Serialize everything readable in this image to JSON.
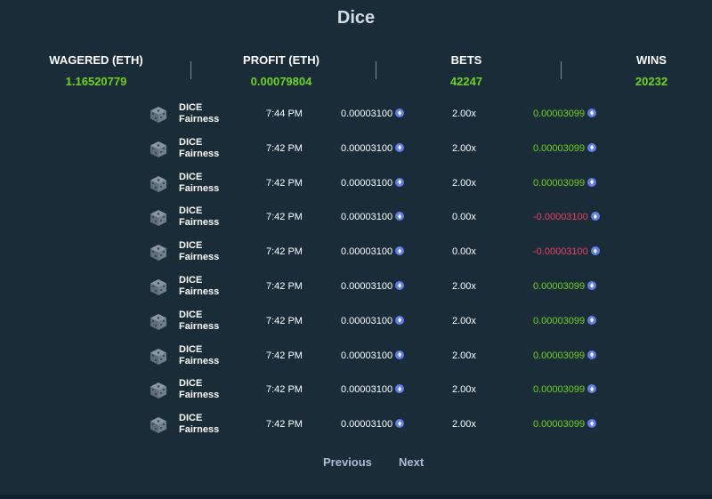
{
  "page": {
    "title": "Dice"
  },
  "stats": [
    {
      "label": "WAGERED (ETH)",
      "value": "1.16520779"
    },
    {
      "label": "PROFIT (ETH)",
      "value": "0.00079804"
    },
    {
      "label": "BETS",
      "value": "42247"
    },
    {
      "label": "WINS",
      "value": "20232"
    }
  ],
  "colors": {
    "positive": "#6fd322",
    "negative": "#ed4163",
    "eth_icon": "#627eea",
    "background": "#1a2c38"
  },
  "bet_rows": [
    {
      "game": "DICE",
      "link": "Fairness",
      "time": "7:44 PM",
      "amount": "0.00003100",
      "multiplier": "2.00x",
      "profit": "0.00003099",
      "outcome": "win"
    },
    {
      "game": "DICE",
      "link": "Fairness",
      "time": "7:42 PM",
      "amount": "0.00003100",
      "multiplier": "2.00x",
      "profit": "0.00003099",
      "outcome": "win"
    },
    {
      "game": "DICE",
      "link": "Fairness",
      "time": "7:42 PM",
      "amount": "0.00003100",
      "multiplier": "2.00x",
      "profit": "0.00003099",
      "outcome": "win"
    },
    {
      "game": "DICE",
      "link": "Fairness",
      "time": "7:42 PM",
      "amount": "0.00003100",
      "multiplier": "0.00x",
      "profit": "-0.00003100",
      "outcome": "loss"
    },
    {
      "game": "DICE",
      "link": "Fairness",
      "time": "7:42 PM",
      "amount": "0.00003100",
      "multiplier": "0.00x",
      "profit": "-0.00003100",
      "outcome": "loss"
    },
    {
      "game": "DICE",
      "link": "Fairness",
      "time": "7:42 PM",
      "amount": "0.00003100",
      "multiplier": "2.00x",
      "profit": "0.00003099",
      "outcome": "win"
    },
    {
      "game": "DICE",
      "link": "Fairness",
      "time": "7:42 PM",
      "amount": "0.00003100",
      "multiplier": "2.00x",
      "profit": "0.00003099",
      "outcome": "win"
    },
    {
      "game": "DICE",
      "link": "Fairness",
      "time": "7:42 PM",
      "amount": "0.00003100",
      "multiplier": "2.00x",
      "profit": "0.00003099",
      "outcome": "win"
    },
    {
      "game": "DICE",
      "link": "Fairness",
      "time": "7:42 PM",
      "amount": "0.00003100",
      "multiplier": "2.00x",
      "profit": "0.00003099",
      "outcome": "win"
    },
    {
      "game": "DICE",
      "link": "Fairness",
      "time": "7:42 PM",
      "amount": "0.00003100",
      "multiplier": "2.00x",
      "profit": "0.00003099",
      "outcome": "win"
    }
  ],
  "icons": {
    "game": "dice-icon",
    "currency": "eth-icon"
  },
  "pagination": {
    "previous": "Previous",
    "next": "Next"
  }
}
